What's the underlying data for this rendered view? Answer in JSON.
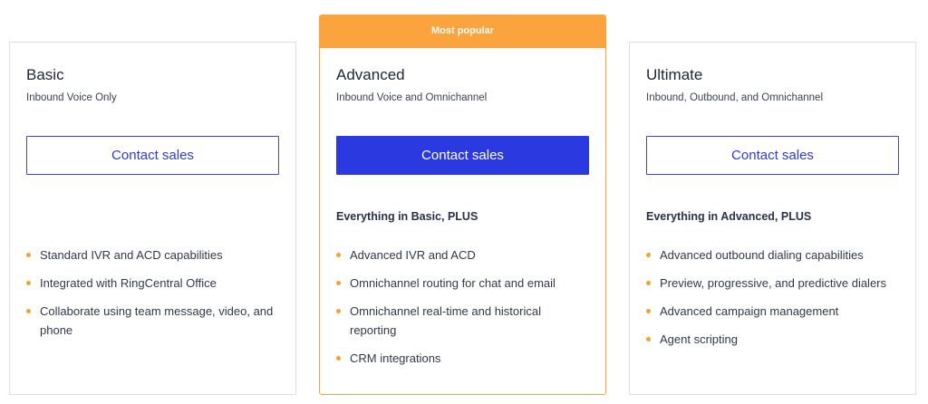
{
  "plans": [
    {
      "name": "Basic",
      "description": "Inbound Voice Only",
      "cta_label": "Contact sales",
      "intro": "",
      "features": [
        "Standard IVR and ACD capabilities",
        "Integrated with RingCentral Office",
        "Collaborate using team message, video, and phone"
      ]
    },
    {
      "badge": "Most popular",
      "name": "Advanced",
      "description": "Inbound Voice and Omnichannel",
      "cta_label": "Contact sales",
      "intro": "Everything in Basic, PLUS",
      "features": [
        "Advanced IVR and ACD",
        "Omnichannel routing for chat and email",
        "Omnichannel real-time and historical reporting",
        "CRM integrations"
      ]
    },
    {
      "name": "Ultimate",
      "description": "Inbound, Outbound, and Omnichannel",
      "cta_label": "Contact sales",
      "intro": "Everything in Advanced, PLUS",
      "features": [
        "Advanced outbound dialing capabilities",
        "Preview, progressive, and predictive dialers",
        "Advanced campaign management",
        "Agent scripting"
      ]
    }
  ],
  "colors": {
    "accent_orange": "#fba33c",
    "primary_blue": "#2b3ae0",
    "border_gray": "#dcdfe4"
  }
}
